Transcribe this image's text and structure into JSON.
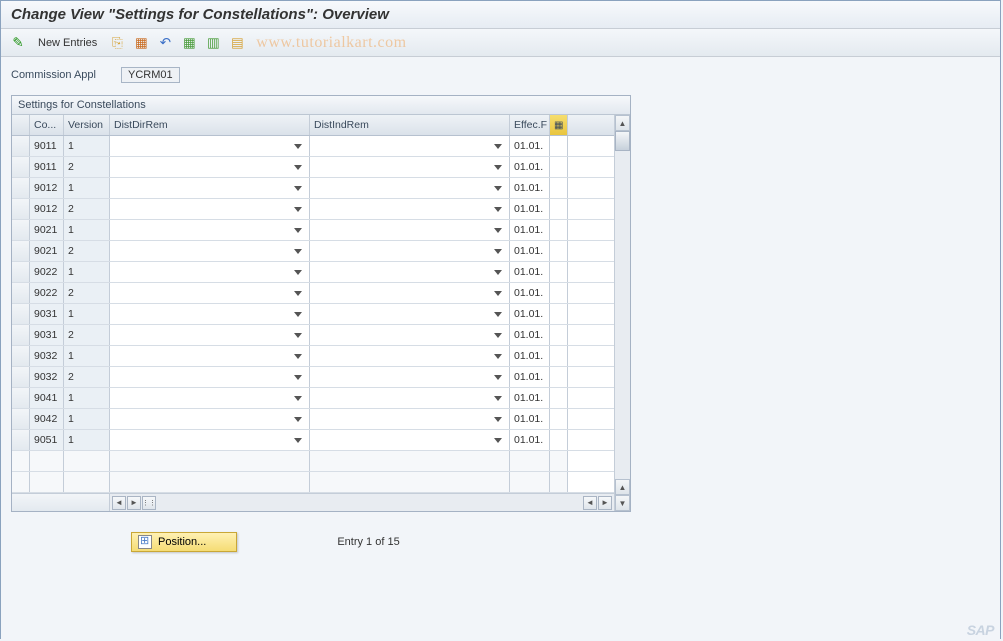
{
  "title": "Change View \"Settings for Constellations\": Overview",
  "toolbar": {
    "new_entries": "New Entries"
  },
  "watermark": "www.tutorialkart.com",
  "field": {
    "label": "Commission Appl",
    "value": "YCRM01"
  },
  "grid": {
    "title": "Settings for Constellations",
    "headers": {
      "co": "Co...",
      "version": "Version",
      "distdir": "DistDirRem",
      "distind": "DistIndRem",
      "effec": "Effec.F"
    },
    "rows": [
      {
        "co": "9011",
        "ver": "1",
        "eff": "01.01."
      },
      {
        "co": "9011",
        "ver": "2",
        "eff": "01.01."
      },
      {
        "co": "9012",
        "ver": "1",
        "eff": "01.01."
      },
      {
        "co": "9012",
        "ver": "2",
        "eff": "01.01."
      },
      {
        "co": "9021",
        "ver": "1",
        "eff": "01.01."
      },
      {
        "co": "9021",
        "ver": "2",
        "eff": "01.01."
      },
      {
        "co": "9022",
        "ver": "1",
        "eff": "01.01."
      },
      {
        "co": "9022",
        "ver": "2",
        "eff": "01.01."
      },
      {
        "co": "9031",
        "ver": "1",
        "eff": "01.01."
      },
      {
        "co": "9031",
        "ver": "2",
        "eff": "01.01."
      },
      {
        "co": "9032",
        "ver": "1",
        "eff": "01.01."
      },
      {
        "co": "9032",
        "ver": "2",
        "eff": "01.01."
      },
      {
        "co": "9041",
        "ver": "1",
        "eff": "01.01."
      },
      {
        "co": "9042",
        "ver": "1",
        "eff": "01.01."
      },
      {
        "co": "9051",
        "ver": "1",
        "eff": "01.01."
      }
    ]
  },
  "footer": {
    "position_label": "Position...",
    "entry_text": "Entry 1 of 15"
  },
  "sap": "SAP"
}
